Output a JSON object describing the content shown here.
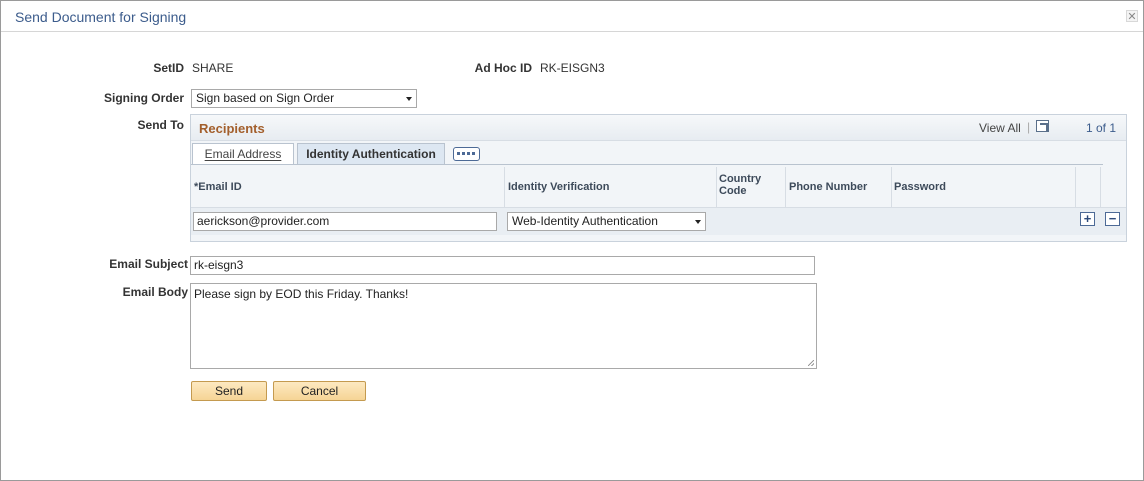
{
  "window": {
    "title": "Send Document for Signing",
    "close_label": "✕"
  },
  "header": {
    "setid_label": "SetID",
    "setid_value": "SHARE",
    "adhoc_label": "Ad Hoc ID",
    "adhoc_value": "RK-EISGN3"
  },
  "signing_order": {
    "label": "Signing Order",
    "selected": "Sign based on Sign Order"
  },
  "send_to": {
    "label": "Send To",
    "grid_title": "Recipients",
    "view_all": "View All",
    "pager": "1 of 1",
    "tabs": [
      {
        "label": "Email Address",
        "active": false
      },
      {
        "label": "Identity Authentication",
        "active": true
      }
    ],
    "columns": {
      "email_id": "*Email ID",
      "identity_verification": "Identity Verification",
      "country_code": "Country Code",
      "phone_number": "Phone Number",
      "password": "Password"
    },
    "rows": [
      {
        "email": "aerickson@provider.com",
        "identity_verification": "Web-Identity Authentication",
        "country_code": "",
        "phone_number": "",
        "password": ""
      }
    ],
    "add_row_symbol": "+",
    "delete_row_symbol": "−"
  },
  "email_subject": {
    "label": "Email Subject",
    "value": "rk-eisgn3"
  },
  "email_body": {
    "label": "Email Body",
    "value": "Please sign by EOD this Friday.  Thanks!"
  },
  "actions": {
    "send_label": "Send",
    "cancel_label": "Cancel"
  },
  "colors": {
    "title": "#3c5c8c",
    "grid_title": "#a35f2c",
    "button_fill": "#f6d495",
    "grid_background": "#f2f5f8"
  }
}
